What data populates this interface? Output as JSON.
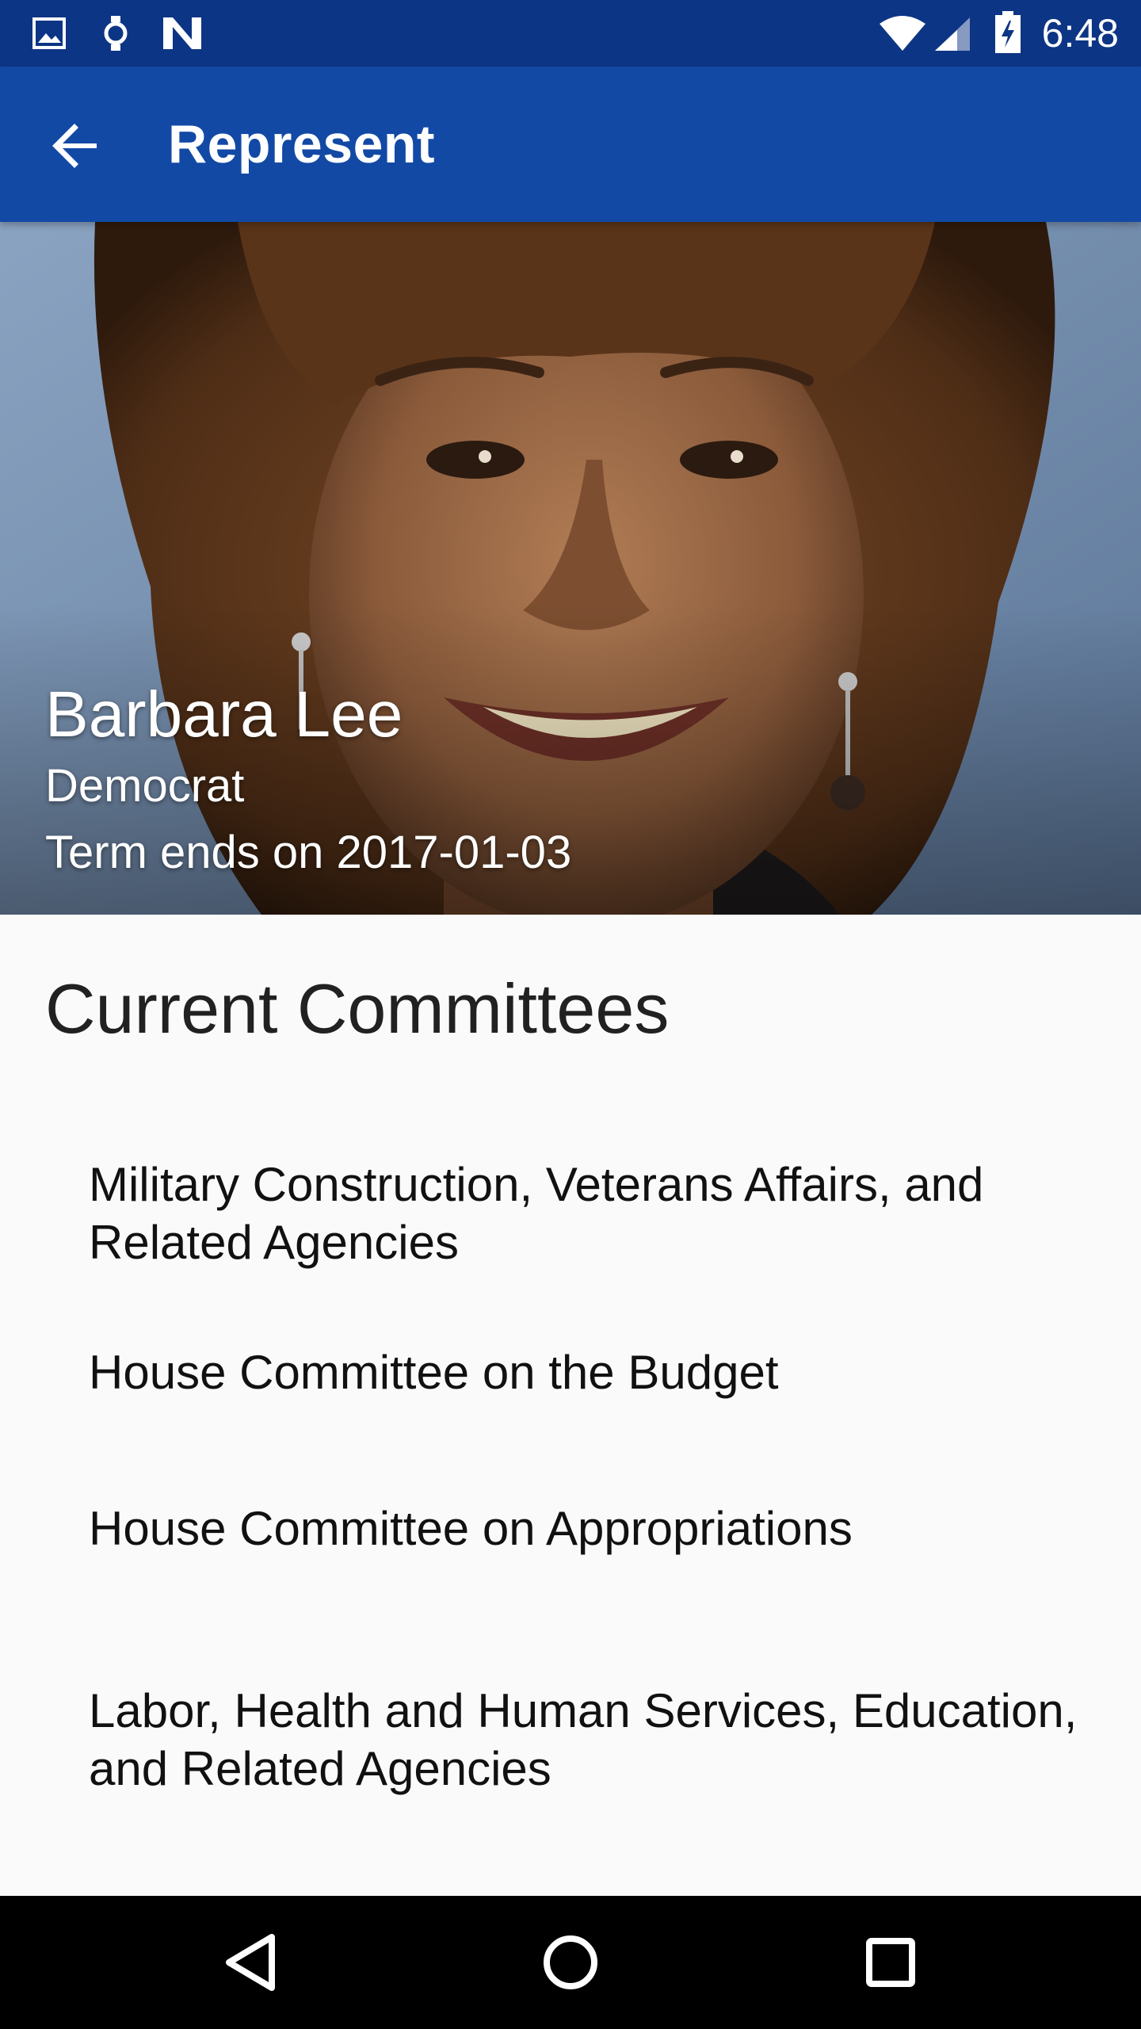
{
  "status_bar": {
    "time": "6:48",
    "icons": [
      "image-notification-icon",
      "watch-icon",
      "n-app-icon",
      "wifi-icon",
      "cell-signal-icon",
      "battery-charging-icon"
    ]
  },
  "app_bar": {
    "title": "Represent",
    "back_icon": "arrow-back-icon"
  },
  "profile": {
    "name": "Barbara Lee",
    "party": "Democrat",
    "term": "Term ends on 2017-01-03"
  },
  "committees": {
    "title": "Current Committees",
    "items": [
      {
        "label": "Military Construction, Veterans Affairs, and Related Agencies"
      },
      {
        "label": "House Committee on the Budget"
      },
      {
        "label": "House Committee on Appropriations"
      },
      {
        "label": "Labor, Health and Human Services, Education, and Related Agencies"
      }
    ]
  },
  "nav_bar": {
    "icons": [
      "back-triangle-icon",
      "home-circle-icon",
      "recents-square-icon"
    ]
  },
  "colors": {
    "status_bar": "#0d3585",
    "app_bar": "#1249a5",
    "background": "#fafafa",
    "nav_bar": "#000000"
  }
}
